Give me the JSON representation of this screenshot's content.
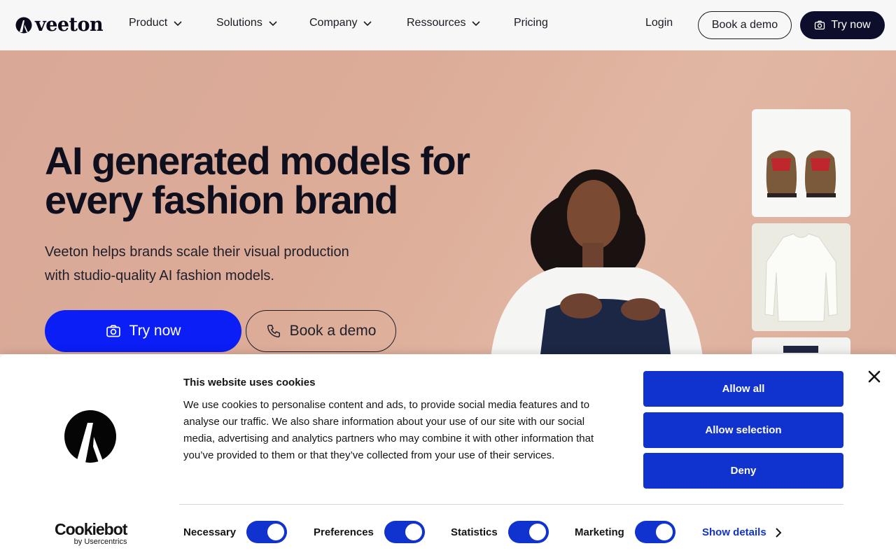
{
  "nav": {
    "logo_text": "veeton",
    "items": [
      {
        "label": "Product"
      },
      {
        "label": "Solutions"
      },
      {
        "label": "Company"
      },
      {
        "label": "Ressources"
      }
    ],
    "pricing": "Pricing",
    "login": "Login",
    "book_demo": "Book a demo",
    "try_now": "Try now"
  },
  "hero": {
    "title_line1": "AI generated models for",
    "title_line2": "every fashion brand",
    "subtitle_line1": "Veeton helps brands scale their visual production",
    "subtitle_line2": "with studio-quality AI fashion models.",
    "cta_primary": "Try now",
    "cta_secondary": "Book a demo"
  },
  "cookie_banner": {
    "title": "This website uses cookies",
    "text": "We use cookies to personalise content and ads, to provide social media features and to analyse our traffic. We also share information about your use of our site with our social media, advertising and analytics partners who may combine it with other information that you’ve provided to them or that they’ve collected from your use of their services.",
    "allow_all": "Allow all",
    "allow_selection": "Allow selection",
    "deny": "Deny",
    "toggles": [
      {
        "label": "Necessary",
        "checked": true
      },
      {
        "label": "Preferences",
        "checked": true
      },
      {
        "label": "Statistics",
        "checked": true
      },
      {
        "label": "Marketing",
        "checked": true
      }
    ],
    "show_details": "Show details",
    "brand_main": "Cookiebot",
    "brand_sub": "by Usercentrics"
  },
  "colors": {
    "primary_blue": "#0a1ef5",
    "cookie_blue": "#1032cf",
    "dark_navy": "#0d0e2b",
    "hero_bg": "#dcac98"
  }
}
